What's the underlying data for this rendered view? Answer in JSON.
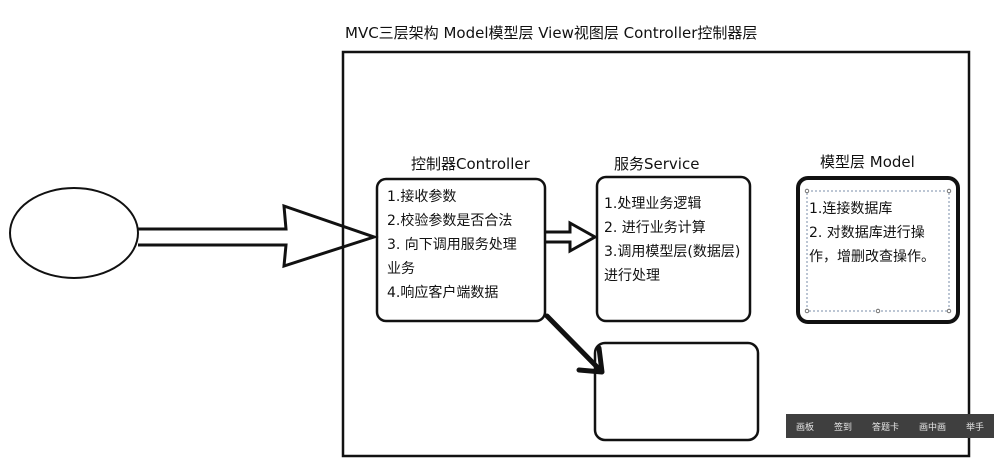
{
  "title": "MVC三层架构  Model模型层 View视图层 Controller控制器层",
  "controller": {
    "label": "控制器Controller",
    "lines": [
      "1.接收参数",
      "2.校验参数是否合法",
      "3. 向下调用服务处理",
      "业务",
      "4.响应客户端数据"
    ]
  },
  "service": {
    "label": "服务Service",
    "lines": [
      "1.处理业务逻辑",
      "2. 进行业务计算",
      "3.调用模型层(数据层)",
      "进行处理"
    ]
  },
  "model": {
    "label": "模型层 Model",
    "lines": [
      "1.连接数据库",
      "2. 对数据库进行操",
      "作，增删改查操作。"
    ]
  },
  "toolbar": {
    "items": [
      "画板",
      "签到",
      "答题卡",
      "画中画",
      "举手"
    ]
  }
}
